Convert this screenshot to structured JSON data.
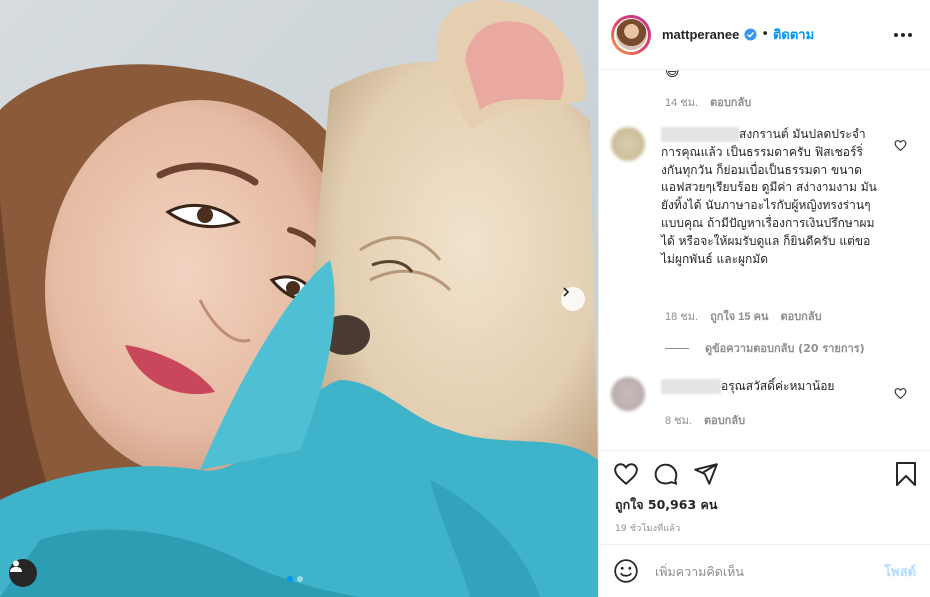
{
  "photo": {
    "dots": [
      true,
      false
    ]
  },
  "header": {
    "username": "mattperanee",
    "separator": "•",
    "follow_label": "ติดตาม"
  },
  "comments": {
    "top_emoji": "😃",
    "top_meta": {
      "time": "14 ชม.",
      "reply": "ตอบกลับ"
    },
    "items": [
      {
        "text": "สงกรานต์ มันปลดประจำการคุณแล้ว เป็นธรรมดาครับ ฟิสเชอร์ริ่งกันทุกวัน ก็ย่อมเบื่อเป็นธรรมดา ขนาดแอฟสวยๆเรียบร้อย ดูมีค่า สง่างามงาม มันยังทิ้งได้ นับภาษาอะไรกับผู้หญิงทรงร่านๆแบบคุณ ถ้ามีปัญหาเรื่องการเงินปรึกษาผมได้ หรือจะให้ผมรับดูแล ก็ยินดีครับ แต่ขอไม่ผูกพันธ์ และผูกมัด",
        "time": "18 ชม.",
        "likes": "ถูกใจ 15 คน",
        "reply": "ตอบกลับ"
      },
      {
        "text": "อรุณสวัสดิ์ค่ะหมาน้อย",
        "time": "8 ชม.",
        "reply": "ตอบกลับ"
      }
    ],
    "view_replies": "ดูข้อความตอบกลับ (20 รายการ)"
  },
  "actions": {
    "likes": "ถูกใจ 50,963 คน",
    "time_ago": "19 ชั่วโมงที่แล้ว"
  },
  "add_comment": {
    "placeholder": "เพิ่มความคิดเห็น",
    "post_label": "โพสต์"
  },
  "colors": {
    "accent": "#0095f6",
    "blanket": "#3fb3c9",
    "post_disabled": "#b3dbff"
  }
}
